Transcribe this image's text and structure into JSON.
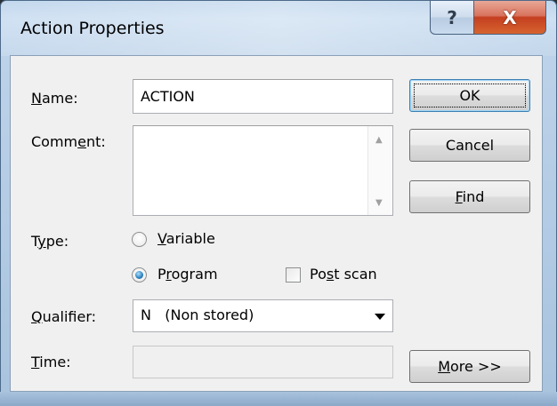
{
  "window": {
    "title": "Action Properties",
    "help_glyph": "?",
    "close_glyph": "X"
  },
  "form": {
    "name": {
      "label_pre": "",
      "label_ul": "N",
      "label_post": "ame:",
      "value": "ACTION"
    },
    "comment": {
      "label_pre": "Comm",
      "label_ul": "e",
      "label_post": "nt:",
      "value": ""
    },
    "type": {
      "label_pre": "T",
      "label_ul": "y",
      "label_post": "pe:",
      "options": [
        {
          "label_pre": "",
          "label_ul": "V",
          "label_post": "ariable",
          "selected": false
        },
        {
          "label_pre": "P",
          "label_ul": "r",
          "label_post": "ogram",
          "selected": true
        }
      ]
    },
    "post_scan": {
      "label_pre": "Po",
      "label_ul": "s",
      "label_post": "t scan",
      "checked": false
    },
    "qualifier": {
      "label_pre": "",
      "label_ul": "Q",
      "label_post": "ualifier:",
      "value": "N   (Non stored)"
    },
    "time": {
      "label_pre": "",
      "label_ul": "T",
      "label_post": "ime:",
      "value": ""
    }
  },
  "buttons": {
    "ok": {
      "label": "OK"
    },
    "cancel": {
      "label": "Cancel"
    },
    "find": {
      "label_pre": "",
      "label_ul": "F",
      "label_post": "ind"
    },
    "more": {
      "label_pre": "",
      "label_ul": "M",
      "label_post": "ore >>"
    }
  },
  "icons": {
    "help": "help-icon",
    "close": "close-icon",
    "scroll_up": "scroll-up-arrow-icon",
    "scroll_down": "scroll-down-arrow-icon",
    "dropdown": "chevron-down-icon"
  },
  "colors": {
    "title_gradient_top": "#b9d1ea",
    "close_button": "#c43f20",
    "dialog_face": "#f0f0f0",
    "default_button_border": "#3c7fb1"
  }
}
